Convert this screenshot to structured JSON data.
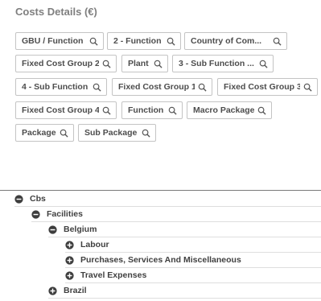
{
  "panel": {
    "title": "Costs Details (€)"
  },
  "filters": [
    {
      "label": "GBU / Function",
      "icon": "search-icon"
    },
    {
      "label": "2 - Function",
      "icon": "search-icon"
    },
    {
      "label": "Country of Com...",
      "icon": "search-icon"
    },
    {
      "label": "Fixed Cost Group 2",
      "icon": "search-icon"
    },
    {
      "label": "Plant",
      "icon": "search-icon"
    },
    {
      "label": "3 - Sub Function ...",
      "icon": "search-icon"
    },
    {
      "label": "4 - Sub Function",
      "icon": "search-icon"
    },
    {
      "label": "Fixed Cost Group 1",
      "icon": "search-icon"
    },
    {
      "label": "Fixed Cost Group 3",
      "icon": "search-icon"
    },
    {
      "label": "Fixed Cost Group 4",
      "icon": "search-icon"
    },
    {
      "label": "Function",
      "icon": "search-icon"
    },
    {
      "label": "Macro Package",
      "icon": "search-icon"
    },
    {
      "label": "Package",
      "icon": "search-icon"
    },
    {
      "label": "Sub Package",
      "icon": "search-icon"
    }
  ],
  "tree": [
    {
      "label": "Cbs",
      "state": "expanded",
      "icon": "minus-circle-icon"
    },
    {
      "label": "Facilities",
      "state": "expanded",
      "icon": "minus-circle-icon"
    },
    {
      "label": "Belgium",
      "state": "expanded",
      "icon": "minus-circle-icon"
    },
    {
      "label": "Labour",
      "state": "collapsed",
      "icon": "plus-circle-icon"
    },
    {
      "label": "Purchases, Services And Miscellaneous",
      "state": "collapsed",
      "icon": "plus-circle-icon"
    },
    {
      "label": "Travel Expenses",
      "state": "collapsed",
      "icon": "plus-circle-icon"
    },
    {
      "label": "Brazil",
      "state": "collapsed",
      "icon": "plus-circle-icon"
    }
  ],
  "colors": {
    "toggle": "#3d3d3d",
    "chip_border": "#c4c4c4",
    "title": "#7f7f7f"
  }
}
